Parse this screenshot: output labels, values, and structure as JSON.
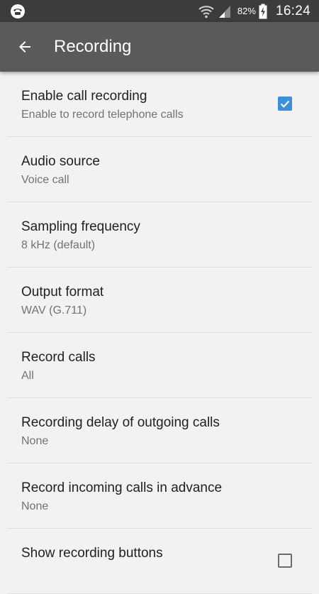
{
  "status_bar": {
    "battery_percent": "82%",
    "time": "16:24"
  },
  "app_bar": {
    "title": "Recording"
  },
  "settings": [
    {
      "title": "Enable call recording",
      "summary": "Enable to record telephone calls",
      "checkbox": true
    },
    {
      "title": "Audio source",
      "summary": "Voice call"
    },
    {
      "title": "Sampling frequency",
      "summary": "8 kHz (default)"
    },
    {
      "title": "Output format",
      "summary": "WAV (G.711)"
    },
    {
      "title": "Record calls",
      "summary": "All"
    },
    {
      "title": "Recording delay of outgoing calls",
      "summary": "None"
    },
    {
      "title": "Record incoming calls in advance",
      "summary": "None"
    },
    {
      "title": "Show recording buttons",
      "summary": "",
      "checkbox": false
    }
  ],
  "colors": {
    "status_bar": "#3c3c3c",
    "app_bar": "#5a5a5a",
    "background": "#f2f2f2",
    "accent": "#3b8fe0"
  }
}
